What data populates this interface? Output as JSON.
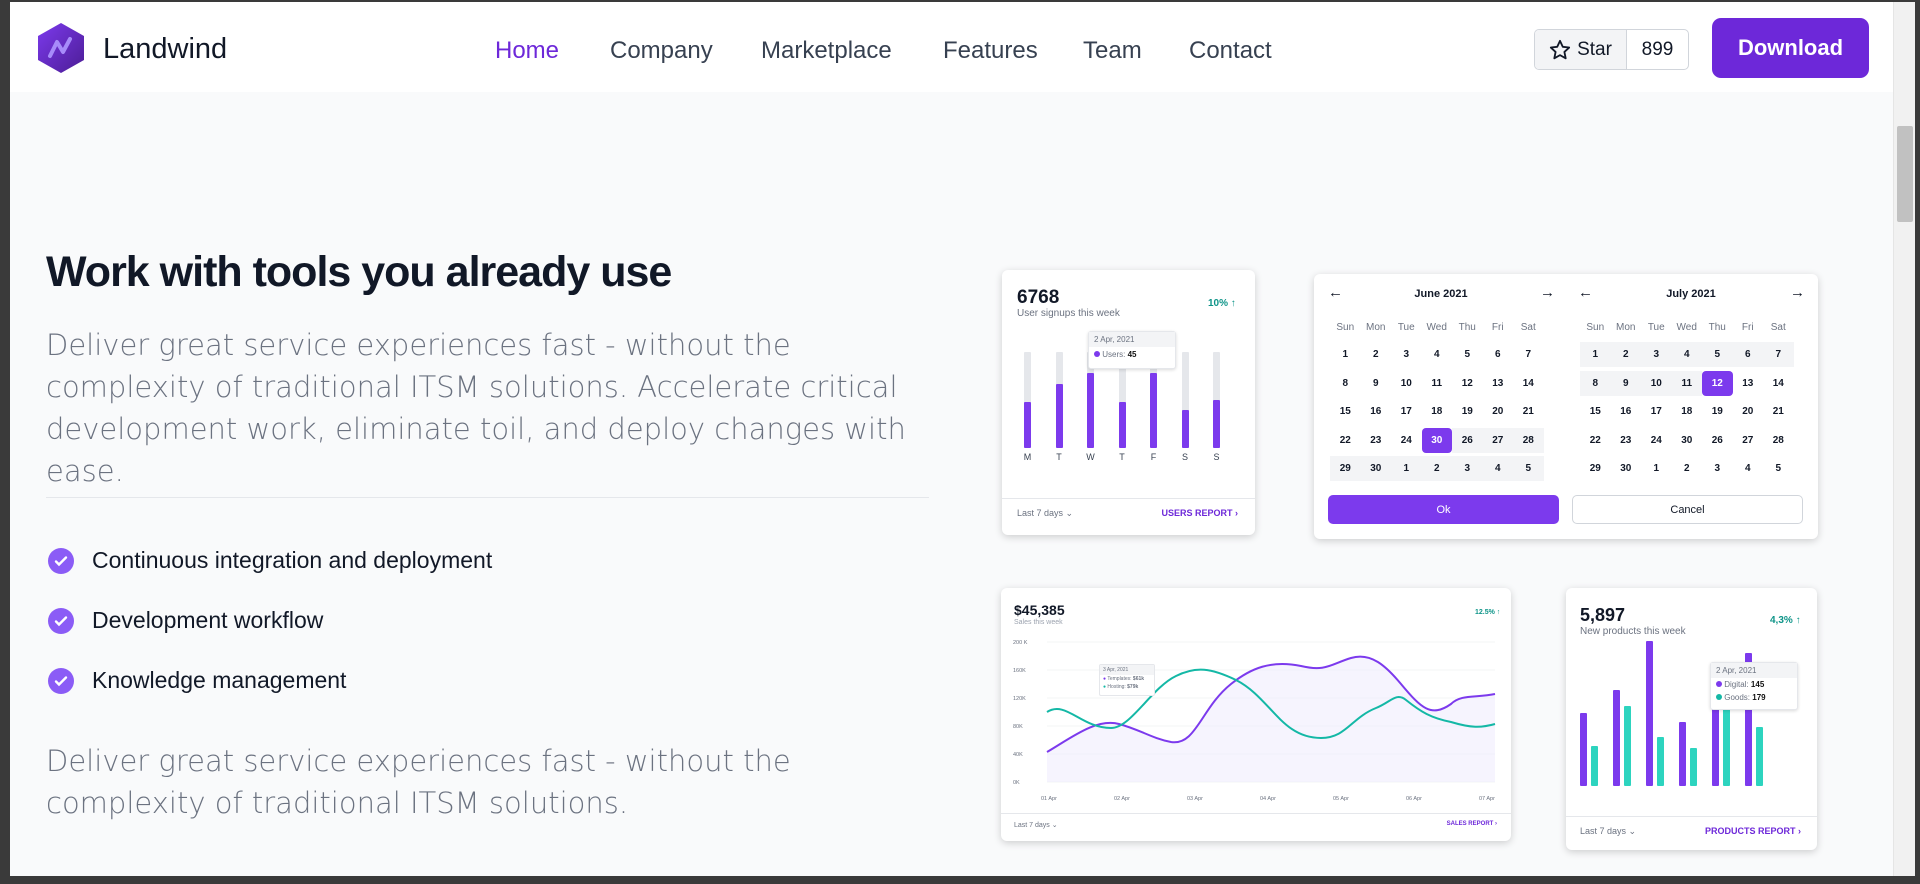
{
  "nav": {
    "brand": "Landwind",
    "links": [
      "Home",
      "Company",
      "Marketplace",
      "Features",
      "Team",
      "Contact"
    ],
    "star_label": "Star",
    "star_count": "899",
    "download_label": "Download"
  },
  "hero": {
    "title": "Work with tools you already use",
    "lead": "Deliver great service experiences fast - without the complexity of traditional ITSM solutions. Accelerate critical development work, eliminate toil, and deploy changes with ease.",
    "features": [
      "Continuous integration and deployment",
      "Development workflow",
      "Knowledge management"
    ],
    "lead2": "Deliver great service experiences fast - without the complexity of traditional ITSM solutions."
  },
  "signups": {
    "value": "6768",
    "subtitle": "User signups this week",
    "change": "10% ↑",
    "tooltip_date": "2 Apr, 2021",
    "tooltip_label": "Users:",
    "tooltip_value": "45",
    "days": [
      "M",
      "T",
      "W",
      "T",
      "F",
      "S",
      "S"
    ],
    "fill": [
      0.48,
      0.67,
      0.78,
      0.48,
      0.78,
      0.4,
      0.5
    ],
    "range": "Last 7 days",
    "report": "USERS REPORT"
  },
  "datepicker": {
    "months": [
      {
        "title": "June 2021",
        "weekdays": [
          "Sun",
          "Mon",
          "Tue",
          "Wed",
          "Thu",
          "Fri",
          "Sat"
        ],
        "rows": [
          [
            "1",
            "2",
            "3",
            "4",
            "5",
            "6",
            "7"
          ],
          [
            "8",
            "9",
            "10",
            "11",
            "12",
            "13",
            "14"
          ],
          [
            "15",
            "16",
            "17",
            "18",
            "19",
            "20",
            "21"
          ],
          [
            "22",
            "23",
            "24",
            "30",
            "26",
            "27",
            "28"
          ],
          [
            "29",
            "30",
            "1",
            "2",
            "3",
            "4",
            "5"
          ]
        ]
      },
      {
        "title": "July 2021",
        "weekdays": [
          "Sun",
          "Mon",
          "Tue",
          "Wed",
          "Thu",
          "Fri",
          "Sat"
        ],
        "rows": [
          [
            "1",
            "2",
            "3",
            "4",
            "5",
            "6",
            "7"
          ],
          [
            "8",
            "9",
            "10",
            "11",
            "12",
            "13",
            "14"
          ],
          [
            "15",
            "16",
            "17",
            "18",
            "19",
            "20",
            "21"
          ],
          [
            "22",
            "23",
            "24",
            "30",
            "26",
            "27",
            "28"
          ],
          [
            "29",
            "30",
            "1",
            "2",
            "3",
            "4",
            "5"
          ]
        ]
      }
    ],
    "ok": "Ok",
    "cancel": "Cancel"
  },
  "sales": {
    "value": "$45,385",
    "subtitle": "Sales this week",
    "change": "12.5% ↑",
    "yticks": [
      "200 K",
      "160K",
      "120K",
      "80K",
      "40K",
      "0K"
    ],
    "xticks": [
      "01 Apr",
      "02 Apr",
      "03 Apr",
      "04 Apr",
      "05 Apr",
      "06 Apr",
      "07 Apr"
    ],
    "tooltip_date": "3 Apr, 2021",
    "tooltip_rows": [
      {
        "label": "Templates:",
        "value": "$61k"
      },
      {
        "label": "Hosting:",
        "value": "$79k"
      }
    ],
    "range": "Last 7 days",
    "report": "SALES REPORT"
  },
  "products": {
    "value": "5,897",
    "subtitle": "New products this week",
    "change": "4,3% ↑",
    "tooltip_date": "2 Apr, 2021",
    "tooltip_rows": [
      {
        "label": "Digital:",
        "value": "145"
      },
      {
        "label": "Goods:",
        "value": "179"
      }
    ],
    "purple": [
      0.49,
      0.65,
      0.98,
      0.43,
      0.72,
      0.9
    ],
    "teal": [
      0.27,
      0.54,
      0.33,
      0.26,
      0.8,
      0.4
    ],
    "range": "Last 7 days",
    "report": "PRODUCTS REPORT"
  }
}
